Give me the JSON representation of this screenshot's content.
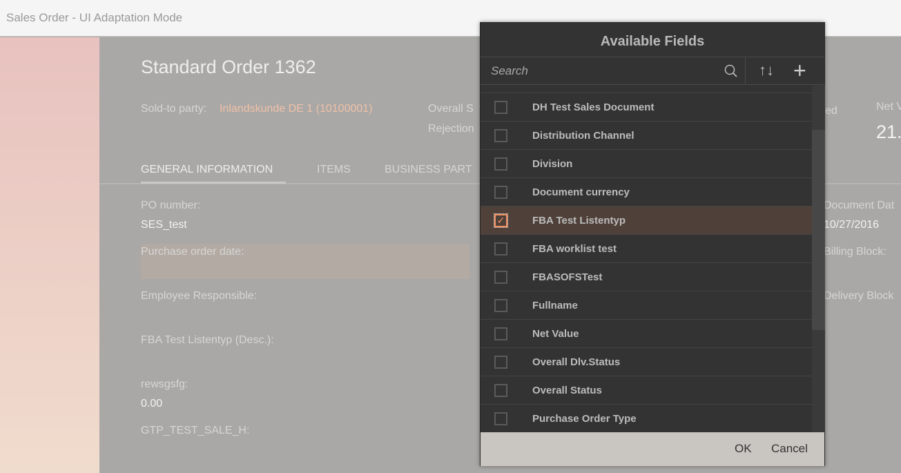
{
  "app": {
    "title": "Sales Order  - UI Adaptation Mode"
  },
  "object": {
    "title": "Standard Order 1362",
    "sold_to_label": "Sold-to party:",
    "sold_to_value": "Inlandskunde DE 1 (10100001)",
    "overall_status_label": "Overall S",
    "rejection_label": "Rejection",
    "status_fragment": "ed",
    "net_value_label": "Net V",
    "net_value": "21."
  },
  "tabs": [
    "GENERAL INFORMATION",
    "ITEMS",
    "BUSINESS PART"
  ],
  "form": {
    "po_number_label": "PO number:",
    "po_number_value": "SES_test",
    "po_date_label": "Purchase order date:",
    "employee_label": "Employee Responsible:",
    "fba_label": "FBA Test Listentyp (Desc.):",
    "rews_label": "rewsgsfg:",
    "rews_value": "0.00",
    "gtp_label": "GTP_TEST_SALE_H:",
    "doc_date_label": "Document Dat",
    "doc_date_value": "10/27/2016",
    "billing_block_label": "Billing Block:",
    "delivery_block_label": "Delivery Block"
  },
  "dialog": {
    "title": "Available Fields",
    "search_placeholder": "Search",
    "ok": "OK",
    "cancel": "Cancel",
    "fields": [
      {
        "label": "DH Test Sales Document",
        "checked": false
      },
      {
        "label": "Distribution Channel",
        "checked": false
      },
      {
        "label": "Division",
        "checked": false
      },
      {
        "label": "Document currency",
        "checked": false
      },
      {
        "label": "FBA Test Listentyp",
        "checked": true
      },
      {
        "label": "FBA worklist test",
        "checked": false
      },
      {
        "label": "FBASOFSTest",
        "checked": false
      },
      {
        "label": "Fullname",
        "checked": false
      },
      {
        "label": "Net Value",
        "checked": false
      },
      {
        "label": "Overall Dlv.Status",
        "checked": false
      },
      {
        "label": "Overall Status",
        "checked": false
      },
      {
        "label": "Purchase Order Type",
        "checked": false
      }
    ]
  },
  "colors": {
    "accent": "#f09060",
    "link": "#f0c0a8",
    "dialog_bg": "#333333",
    "selected_row": "#4f4039"
  }
}
